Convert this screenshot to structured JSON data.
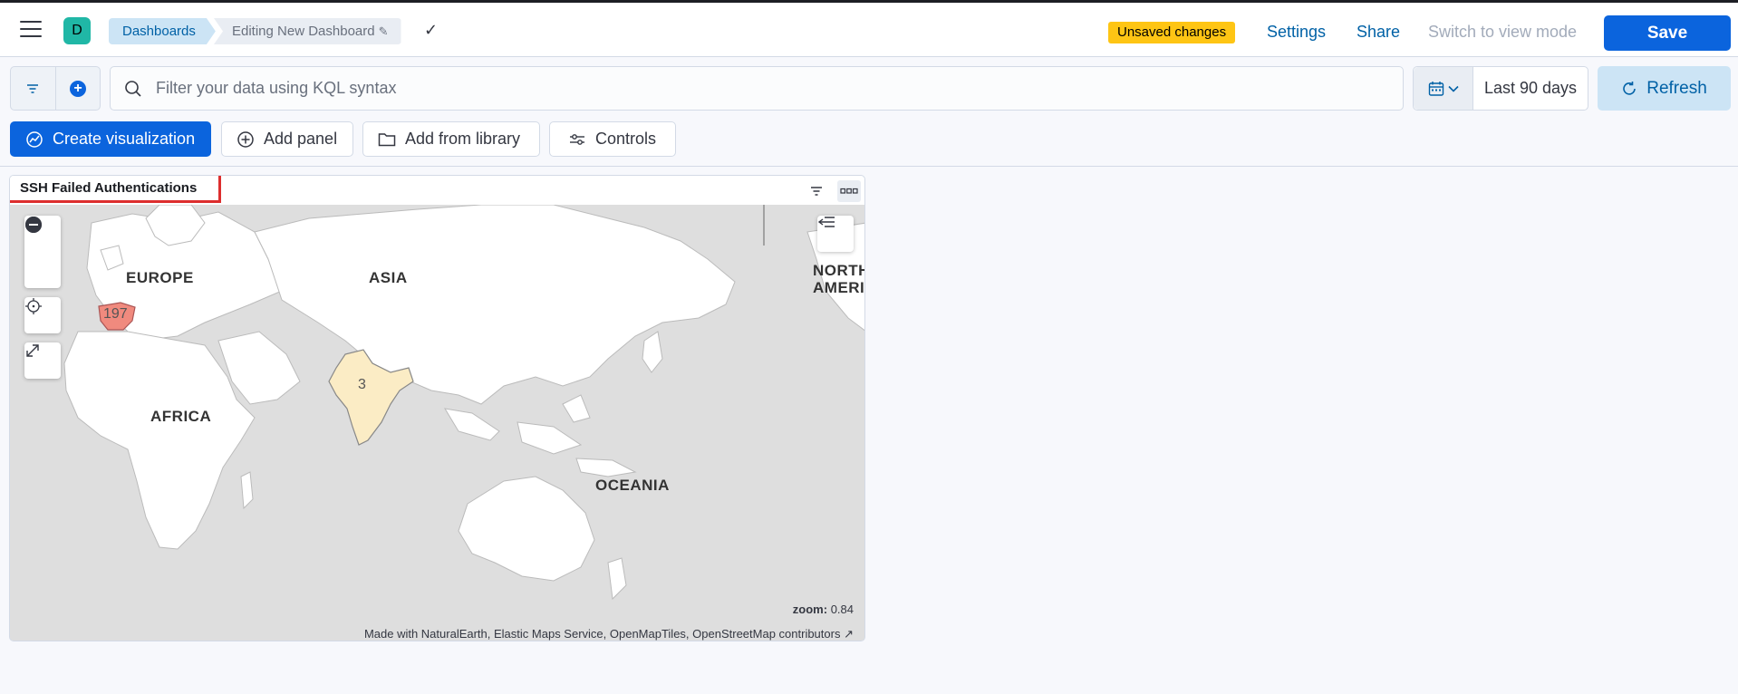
{
  "header": {
    "avatar_letter": "D",
    "breadcrumbs": [
      "Dashboards",
      "Editing New Dashboard"
    ],
    "unsaved_badge": "Unsaved changes",
    "settings": "Settings",
    "share": "Share",
    "switch_mode": "Switch to view mode",
    "save": "Save"
  },
  "query": {
    "placeholder": "Filter your data using KQL syntax",
    "date_range": "Last 90 days",
    "refresh": "Refresh"
  },
  "toolbar": {
    "create_visualization": "Create visualization",
    "add_panel": "Add panel",
    "add_from_library": "Add from library",
    "controls": "Controls"
  },
  "panel": {
    "title": "SSH Failed Authentications",
    "map_labels": {
      "europe": "EUROPE",
      "asia": "ASIA",
      "north_america": "NORTH AMERICA",
      "africa": "AFRICA",
      "oceania": "OCEANIA"
    },
    "regions": [
      {
        "name": "Spain",
        "count": "197",
        "color": "#f08a7e"
      },
      {
        "name": "India",
        "count": "3",
        "color": "#fbecc5"
      }
    ],
    "zoom_label": "zoom:",
    "zoom_value": "0.84",
    "attribution": "Made with NaturalEarth, Elastic Maps Service, OpenMapTiles, OpenStreetMap contributors"
  },
  "colors": {
    "primary": "#0b64dd",
    "badge": "#fec514",
    "highlight_border": "#dd2e2e"
  }
}
